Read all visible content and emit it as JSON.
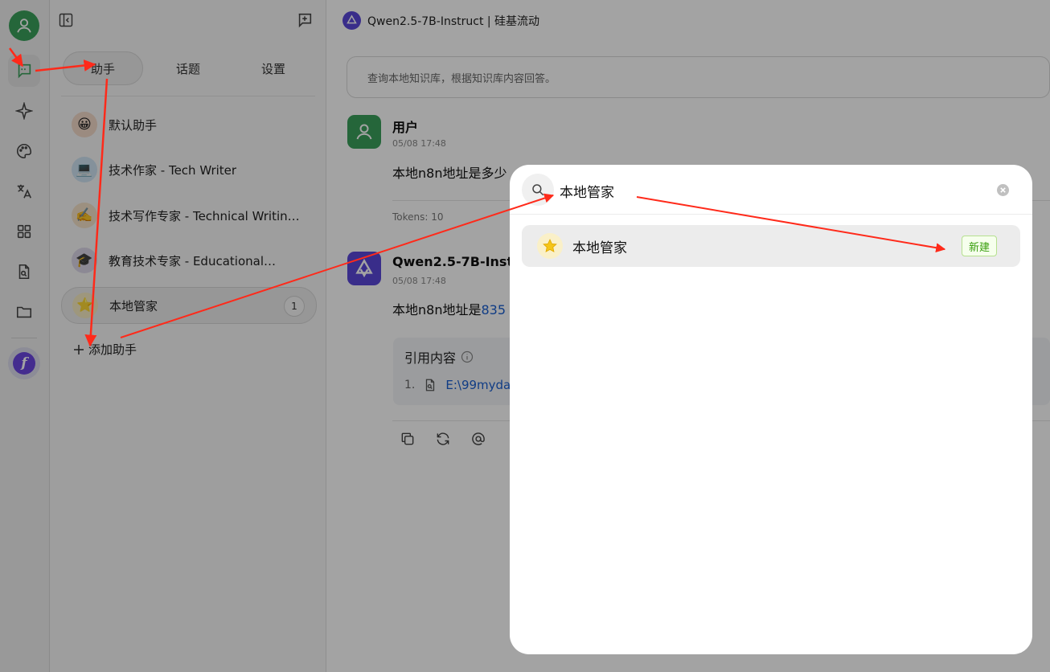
{
  "header": {
    "model_title": "Qwen2.5-7B-Instruct | 硅基流动"
  },
  "sidebar": {
    "tabs": [
      {
        "label": "助手"
      },
      {
        "label": "话题"
      },
      {
        "label": "设置"
      }
    ],
    "assistants": [
      {
        "name": "默认助手",
        "emoji": "😀"
      },
      {
        "name": "技术作家 - Tech Writer",
        "emoji": "💻"
      },
      {
        "name": "技术写作专家 - Technical Writin…",
        "emoji": "✍️"
      },
      {
        "name": "教育技术专家 - Educational…",
        "emoji": "🎓"
      },
      {
        "name": "本地管家",
        "emoji": "⭐",
        "count": "1"
      }
    ],
    "add_label": "添加助手"
  },
  "chat": {
    "kb_placeholder": "查询本地知识库，根据知识库内容回答。",
    "messages": [
      {
        "sender": "用户",
        "time": "05/08 17:48",
        "text": "本地n8n地址是多少",
        "tokens": "Tokens: 10"
      },
      {
        "sender": "Qwen2.5-7B-Instruc",
        "time": "05/08 17:48",
        "text_prefix": "本地n8n地址是",
        "text_link": "835"
      }
    ],
    "citation": {
      "title": "引用内容",
      "items": [
        {
          "num": "1.",
          "path": "E:\\99myda"
        }
      ]
    }
  },
  "modal": {
    "search_value": "本地管家",
    "results": [
      {
        "name": "本地管家",
        "tag": "新建"
      }
    ]
  },
  "colors": {
    "accent_green": "#3aa05b",
    "brand_purple": "#5a47d8",
    "annotation_red": "#ff2a1a",
    "tag_green": "#389e0d"
  }
}
